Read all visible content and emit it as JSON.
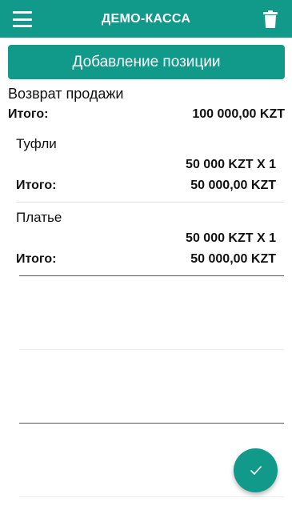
{
  "appbar": {
    "title": "ДЕМО-КАССА",
    "menu_icon": "hamburger-menu-icon",
    "delete_icon": "trash-icon"
  },
  "add_position_label": "Добавление позиции",
  "document_type": "Возврат продажи",
  "total": {
    "label": "Итого:",
    "value": "100 000,00 KZT"
  },
  "items": [
    {
      "name": "Туфли",
      "price_qty": "50 000 KZT X 1",
      "total_label": "Итого:",
      "total_value": "50 000,00 KZT"
    },
    {
      "name": "Платье",
      "price_qty": "50 000 KZT X 1",
      "total_label": "Итого:",
      "total_value": "50 000,00 KZT"
    }
  ],
  "fab": {
    "icon": "check-icon"
  },
  "colors": {
    "primary": "#119a8a",
    "text": "#111111"
  }
}
